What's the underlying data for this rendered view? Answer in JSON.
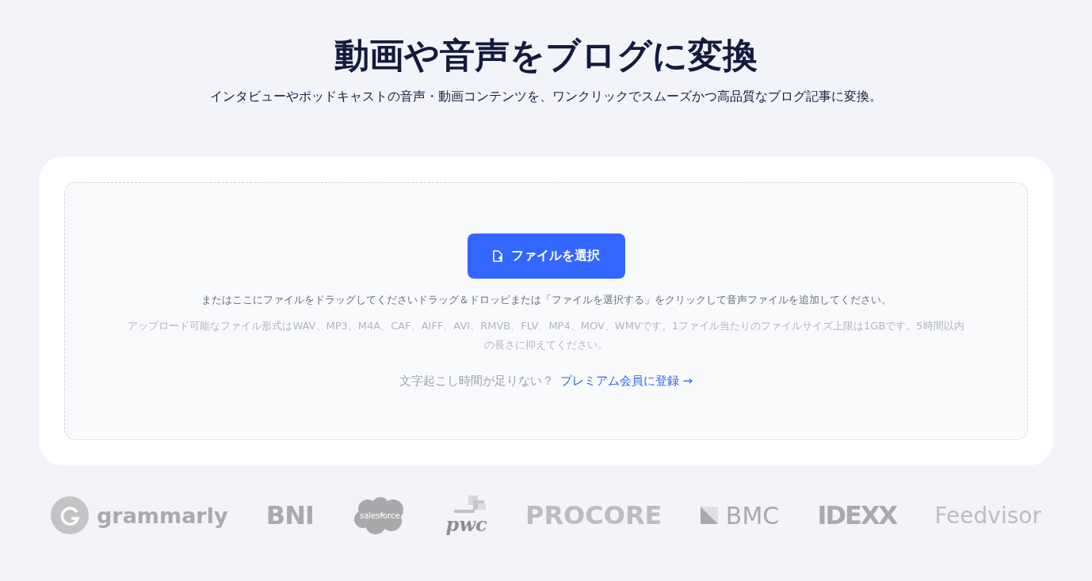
{
  "header": {
    "title": "動画や音声をブログに変換",
    "subtitle": "インタビューやポッドキャストの音声・動画コンテンツを、ワンクリックでスムーズかつ高品質なブログ記事に変換。"
  },
  "upload": {
    "button": "ファイルを選択",
    "instruction": "またはここにファイルをドラッグしてくださいドラッグ＆ドロッピまたは「ファイルを選択する」をクリックして音声ファイルを追加してください。",
    "formats": "アップロード可能なファイル形式はWAV、MP3、M4A、CAF、AIFF、AVI、RMVB、FLV、MP4、MOV、WMVです。1ファイル当たりのファイルサイズ上限は1GBです。5時間以内の長さに抑えてください。",
    "premium_prompt": "文字起こし時間が足りない？",
    "premium_link": "プレミアム会員に登録 →"
  },
  "logos": [
    {
      "text": "grammarly",
      "kind": "circle"
    },
    {
      "text": "BNI",
      "kind": "plain"
    },
    {
      "text": "salesforce",
      "kind": "cloud"
    },
    {
      "text": "pwc",
      "kind": "squares"
    },
    {
      "text": "PROCORE",
      "kind": "plain"
    },
    {
      "text": "BMC",
      "kind": "triangle"
    },
    {
      "text": "IDEXX",
      "kind": "plain"
    },
    {
      "text": "Feedvisor",
      "kind": "plain"
    }
  ]
}
